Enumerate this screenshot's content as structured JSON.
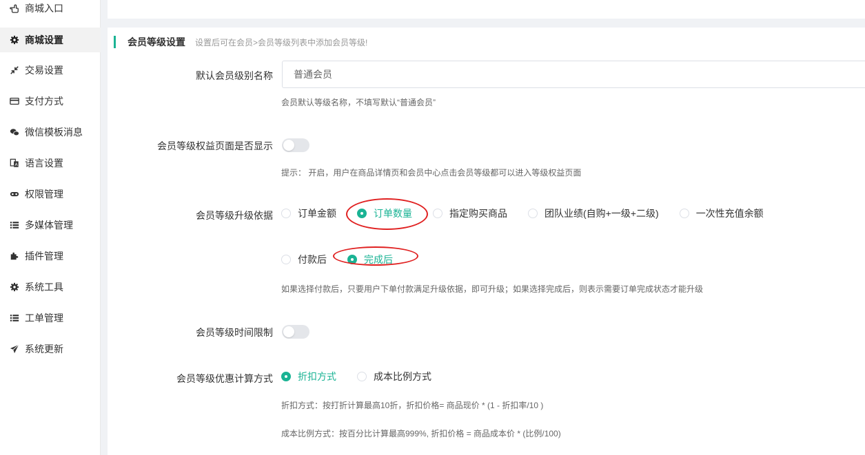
{
  "sidebar": {
    "items": [
      {
        "label": "商城入口",
        "icon": "hand-pointer-icon"
      },
      {
        "label": "商城设置",
        "icon": "gear-icon",
        "active": true
      },
      {
        "label": "交易设置",
        "icon": "compress-arrows-icon"
      },
      {
        "label": "支付方式",
        "icon": "credit-card-icon"
      },
      {
        "label": "微信模板消息",
        "icon": "wechat-icon"
      },
      {
        "label": "语言设置",
        "icon": "translate-icon"
      },
      {
        "label": "权限管理",
        "icon": "gamepad-icon"
      },
      {
        "label": "多媒体管理",
        "icon": "list-icon"
      },
      {
        "label": "插件管理",
        "icon": "puzzle-icon"
      },
      {
        "label": "系统工具",
        "icon": "gear-icon"
      },
      {
        "label": "工单管理",
        "icon": "list-icon"
      },
      {
        "label": "系统更新",
        "icon": "paper-plane-icon"
      }
    ]
  },
  "section": {
    "title": "会员等级设置",
    "subtitle": "设置后可在会员>会员等级列表中添加会员等级!"
  },
  "default_level": {
    "label": "默认会员级别名称",
    "value": "普通会员",
    "hint": "会员默认等级名称，不填写默认“普通会员”"
  },
  "rights_page": {
    "label": "会员等级权益页面是否显示",
    "enabled": false,
    "hint": "提示： 开启，用户在商品详情页和会员中心点击会员等级都可以进入等级权益页面"
  },
  "upgrade_basis": {
    "label": "会员等级升级依据",
    "options": [
      "订单金额",
      "订单数量",
      "指定购买商品",
      "团队业绩(自购+一级+二级)",
      "一次性充值余额"
    ],
    "selected": "订单数量",
    "timing_options": [
      "付款后",
      "完成后"
    ],
    "timing_selected": "完成后",
    "hint": "如果选择付款后，只要用户下单付款满足升级依据，即可升级；如果选择完成后，则表示需要订单完成状态才能升级"
  },
  "time_limit": {
    "label": "会员等级时间限制",
    "enabled": false
  },
  "discount_method": {
    "label": "会员等级优惠计算方式",
    "options": [
      "折扣方式",
      "成本比例方式"
    ],
    "selected": "折扣方式",
    "hint1": "折扣方式：按打折计算最高10折，折扣价格= 商品现价 * (1 - 折扣率/10 )",
    "hint2": "成本比例方式：按百分比计算最高999%, 折扣价格 = 商品成本价 * (比例/100)"
  },
  "colors": {
    "accent": "#1ab394",
    "annotation": "#e02020"
  }
}
